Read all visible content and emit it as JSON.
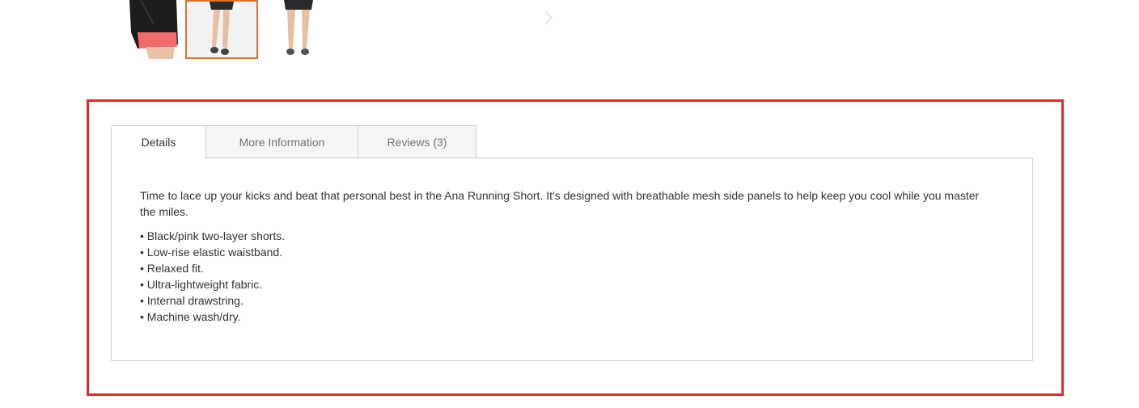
{
  "gallery": {
    "thumbnails": [
      {
        "icon": "product-thumbnail-side-view",
        "selected": false
      },
      {
        "icon": "product-thumbnail-front-view",
        "selected": true
      },
      {
        "icon": "product-thumbnail-back-view",
        "selected": false
      }
    ],
    "next_icon": "chevron-right-icon"
  },
  "tabs": {
    "details_label": "Details",
    "more_info_label": "More Information",
    "reviews_label": "Reviews (3)",
    "active": "Details"
  },
  "details": {
    "description": "Time to lace up your kicks and beat that personal best in the Ana Running Short. It's designed with breathable mesh side panels to help keep you cool while you master the miles.",
    "bullets": [
      "• Black/pink two-layer shorts.",
      "• Low-rise elastic waistband.",
      "• Relaxed fit.",
      "• Ultra-lightweight fabric.",
      "• Internal drawstring.",
      "• Machine wash/dry."
    ]
  },
  "colors": {
    "highlight_border": "#e02b27",
    "selected_thumb_border": "#e06f2c",
    "tab_border": "#d1d1d1",
    "inactive_tab_bg": "#f5f5f5",
    "text": "#333333",
    "inactive_tab_text": "#757575"
  }
}
